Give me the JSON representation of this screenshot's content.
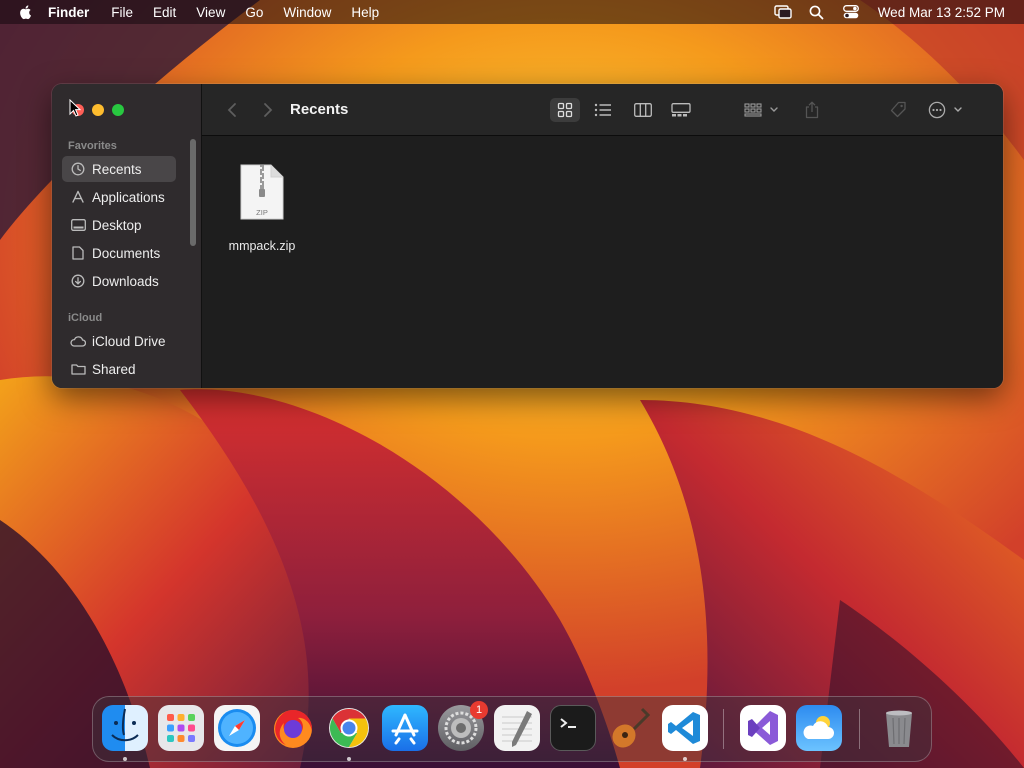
{
  "menubar": {
    "app_name": "Finder",
    "items": [
      "File",
      "Edit",
      "View",
      "Go",
      "Window",
      "Help"
    ],
    "clock": "Wed Mar 13  2:52 PM",
    "status_icons": [
      "screen-mirroring-icon",
      "spotlight-search-icon",
      "control-center-icon"
    ]
  },
  "finder": {
    "title": "Recents",
    "sidebar": {
      "favorites_label": "Favorites",
      "favorites": [
        {
          "label": "Recents",
          "icon": "clock-icon",
          "selected": true
        },
        {
          "label": "Applications",
          "icon": "applications-icon",
          "selected": false
        },
        {
          "label": "Desktop",
          "icon": "desktop-icon",
          "selected": false
        },
        {
          "label": "Documents",
          "icon": "document-icon",
          "selected": false
        },
        {
          "label": "Downloads",
          "icon": "download-icon",
          "selected": false
        }
      ],
      "icloud_label": "iCloud",
      "icloud": [
        {
          "label": "iCloud Drive",
          "icon": "cloud-icon"
        },
        {
          "label": "Shared",
          "icon": "shared-folder-icon"
        }
      ]
    },
    "files": [
      {
        "name": "mmpack.zip",
        "type_label": "ZIP"
      }
    ]
  },
  "dock": {
    "apps": [
      {
        "name": "Finder",
        "running": true
      },
      {
        "name": "Launchpad",
        "running": false
      },
      {
        "name": "Safari",
        "running": false
      },
      {
        "name": "Firefox",
        "running": false
      },
      {
        "name": "Google Chrome",
        "running": true
      },
      {
        "name": "App Store",
        "running": false
      },
      {
        "name": "System Settings",
        "running": false,
        "badge": "1"
      },
      {
        "name": "TextEdit",
        "running": false
      },
      {
        "name": "Terminal",
        "running": false
      },
      {
        "name": "GarageBand",
        "running": false
      },
      {
        "name": "Visual Studio Code",
        "running": true
      },
      {
        "name": "Visual Studio",
        "running": false
      },
      {
        "name": "Weather",
        "running": false
      },
      {
        "name": "Trash",
        "running": false
      }
    ]
  },
  "colors": {
    "close": "#ff5f57",
    "minimize": "#febc2e",
    "maximize": "#28c840",
    "wallpaper_orange": "#f59a1c",
    "wallpaper_red": "#c8232e",
    "wallpaper_purple": "#4a1c46"
  }
}
